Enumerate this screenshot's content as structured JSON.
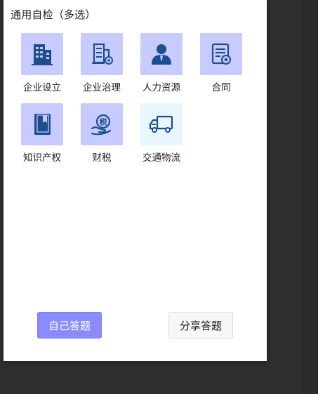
{
  "section": {
    "title": "通用自检（多选）"
  },
  "categories": [
    {
      "label": "企业设立",
      "icon": "building-icon",
      "selected": true
    },
    {
      "label": "企业治理",
      "icon": "building-gear-icon",
      "selected": true
    },
    {
      "label": "人力资源",
      "icon": "person-icon",
      "selected": true
    },
    {
      "label": "合同",
      "icon": "contract-icon",
      "selected": true
    },
    {
      "label": "知识产权",
      "icon": "book-icon",
      "selected": true
    },
    {
      "label": "财税",
      "icon": "tax-hand-icon",
      "selected": true
    },
    {
      "label": "交通物流",
      "icon": "truck-icon",
      "selected": false
    }
  ],
  "actions": {
    "self_answer": "自己答题",
    "share_answer": "分享答题"
  },
  "colors": {
    "tile_selected": "#c7cbff",
    "tile_unselected": "#e8f6fd",
    "icon": "#1f4e8f",
    "primary_button": "#8b8bff"
  }
}
